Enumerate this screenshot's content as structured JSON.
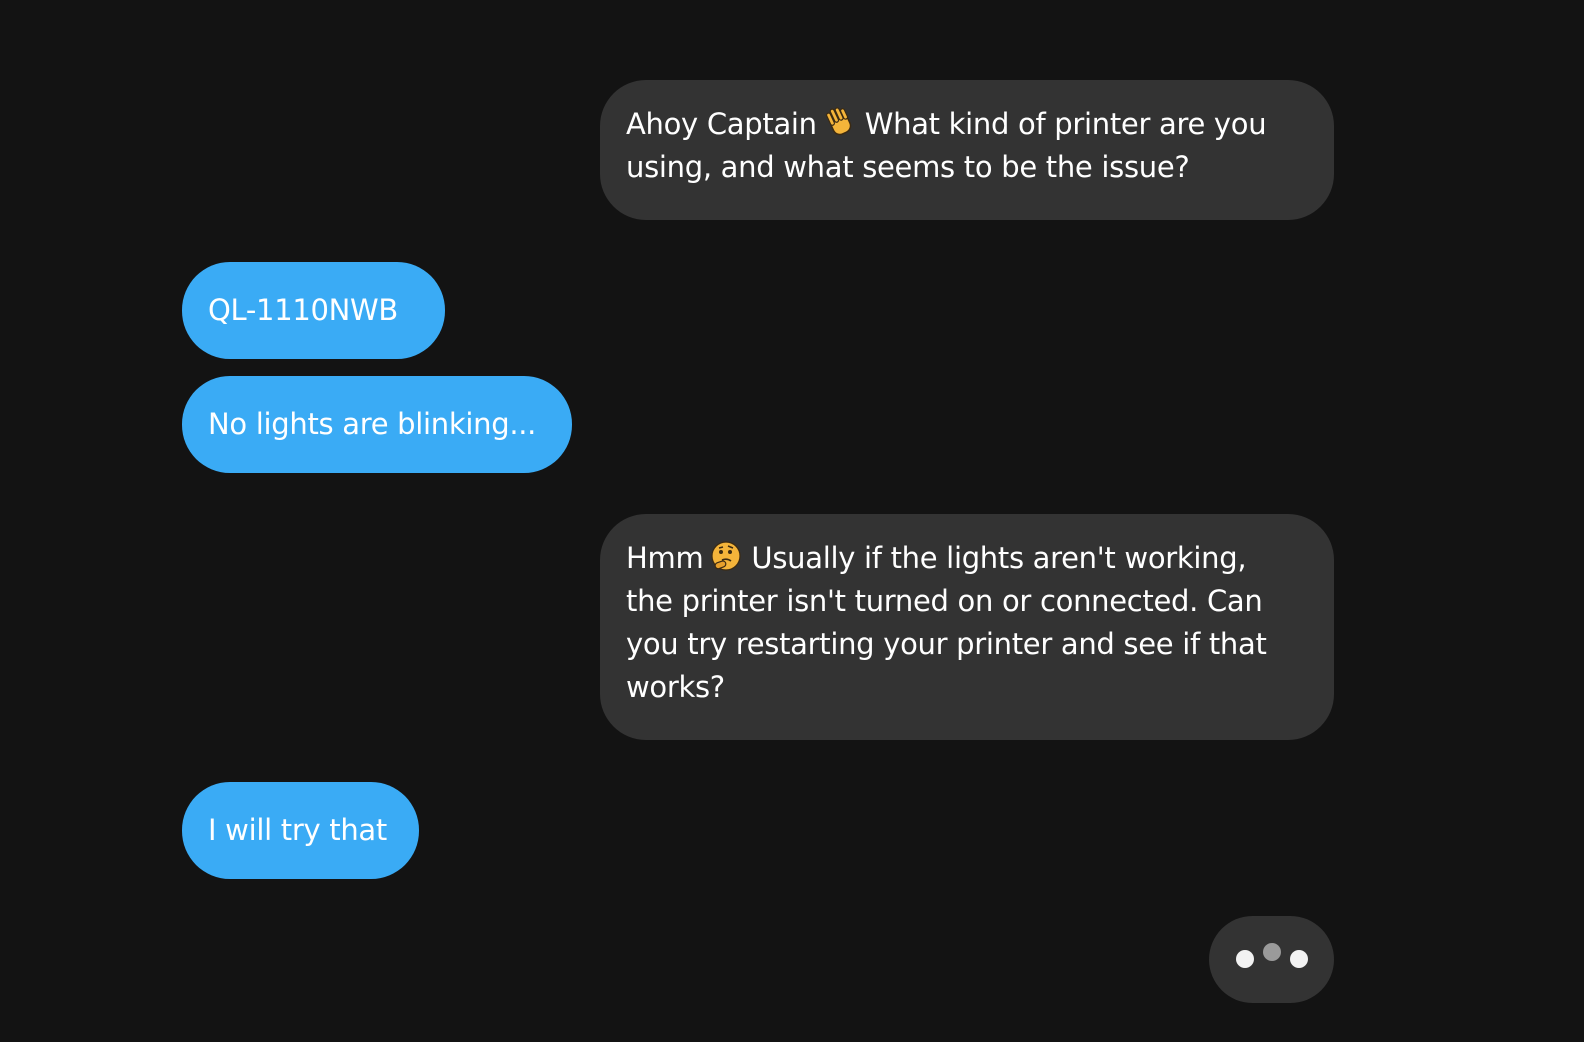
{
  "messages": [
    {
      "sender": "bot",
      "line1_before": "Ahoy Captain",
      "emoji": "waving-hand-icon",
      "line1_after": "What kind of printer are you",
      "line2": "using, and what seems to be the issue?"
    },
    {
      "sender": "user",
      "text": "QL-1110NWB"
    },
    {
      "sender": "user",
      "text": "No lights are blinking..."
    },
    {
      "sender": "bot",
      "line1_before": "Hmm",
      "emoji": "thinking-face-icon",
      "line1_after": "Usually if the lights aren't working,",
      "line2": "the printer isn't turned on or connected. Can",
      "line3": "you try restarting your printer and see if that",
      "line4": "works?"
    },
    {
      "sender": "user",
      "text": "I will try that"
    }
  ],
  "typing_indicator": {
    "visible": true,
    "dots": 3
  },
  "colors": {
    "background": "#131313",
    "bot_bubble": "#333333",
    "user_bubble": "#3aabf5",
    "text": "#ffffff"
  }
}
